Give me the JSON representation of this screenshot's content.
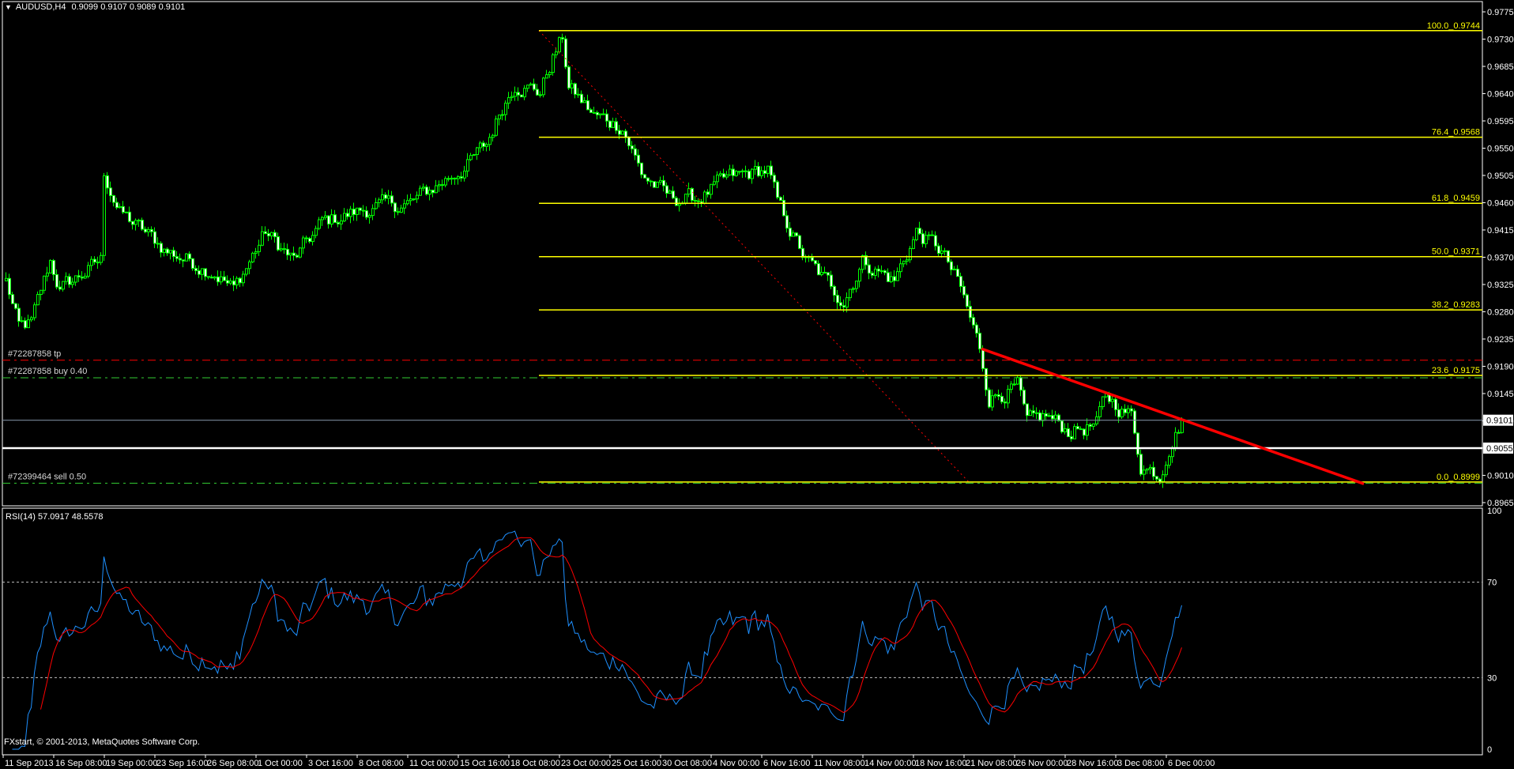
{
  "header": {
    "symbol": "AUDUSD,H4",
    "ohlc": "0.9099 0.9107 0.9089 0.9101",
    "menu_icon": "triangle-down-icon"
  },
  "copyright": "FXstart, © 2001-2013, MetaQuotes Software Corp.",
  "rsi": {
    "label": "RSI(14) 57.0917 48.5578",
    "period": 14,
    "signal_period": 9,
    "levels": [
      70,
      30
    ],
    "axis_labels": [
      {
        "text": "100",
        "value": 100
      },
      {
        "text": "70",
        "value": 70
      },
      {
        "text": "30",
        "value": 30
      },
      {
        "text": "0",
        "value": 0
      }
    ],
    "line_color": "#1e90ff",
    "signal_color": "#ff0000"
  },
  "orders": [
    {
      "label": "#72287858 tp",
      "price": 0.92,
      "color": "#ff0000"
    },
    {
      "label": "#72287858 buy 0.40",
      "price": 0.9171,
      "color": "#32cd32"
    },
    {
      "label": "#72399464 sell 0.50",
      "price": 0.8997,
      "color": "#32cd32"
    }
  ],
  "price_lines": [
    {
      "label": "0.9101",
      "price": 0.9101,
      "color": "#778899"
    },
    {
      "label": "0.9055",
      "price": 0.9055,
      "color": "#ffffff"
    }
  ],
  "chart_data": {
    "type": "candlestick",
    "title": "AUDUSD,H4",
    "bull_color": "#00ff00",
    "price_ticks": [
      "0.9775",
      "0.9730",
      "0.9685",
      "0.9640",
      "0.9595",
      "0.9550",
      "0.9505",
      "0.9460",
      "0.9415",
      "0.9370",
      "0.9325",
      "0.9280",
      "0.9235",
      "0.9190",
      "0.9145",
      "0.9100",
      "0.9055",
      "0.9010",
      "0.8965"
    ],
    "ylim": [
      0.8965,
      0.9775
    ],
    "bars_per_time_tick": 16,
    "time_ticks": [
      "11 Sep 2013",
      "16 Sep 08:00",
      "19 Sep 00:00",
      "23 Sep 16:00",
      "26 Sep 08:00",
      "1 Oct 00:00",
      "3 Oct 16:00",
      "8 Oct 08:00",
      "11 Oct 00:00",
      "15 Oct 16:00",
      "18 Oct 08:00",
      "23 Oct 00:00",
      "25 Oct 16:00",
      "30 Oct 08:00",
      "4 Nov 00:00",
      "6 Nov 16:00",
      "11 Nov 08:00",
      "14 Nov 00:00",
      "18 Nov 16:00",
      "21 Nov 08:00",
      "26 Nov 00:00",
      "28 Nov 16:00",
      "3 Dec 08:00",
      "6 Dec 00:00"
    ],
    "close_path": [
      [
        0,
        0.9331
      ],
      [
        4,
        0.9252
      ],
      [
        8,
        0.926
      ],
      [
        14,
        0.9364
      ],
      [
        17,
        0.9316
      ],
      [
        30,
        0.9364
      ],
      [
        31,
        0.9508
      ],
      [
        36,
        0.9444
      ],
      [
        51,
        0.938
      ],
      [
        66,
        0.9347
      ],
      [
        72,
        0.9316
      ],
      [
        82,
        0.9411
      ],
      [
        91,
        0.9364
      ],
      [
        100,
        0.9427
      ],
      [
        115,
        0.9451
      ],
      [
        128,
        0.9459
      ],
      [
        137,
        0.9491
      ],
      [
        146,
        0.9523
      ],
      [
        152,
        0.9555
      ],
      [
        157,
        0.9619
      ],
      [
        161,
        0.9659
      ],
      [
        169,
        0.9643
      ],
      [
        173,
        0.97
      ],
      [
        176,
        0.9731
      ],
      [
        178,
        0.9651
      ],
      [
        186,
        0.9603
      ],
      [
        195,
        0.9587
      ],
      [
        201,
        0.9508
      ],
      [
        210,
        0.9467
      ],
      [
        219,
        0.9467
      ],
      [
        229,
        0.95
      ],
      [
        241,
        0.9515
      ],
      [
        244,
        0.9459
      ],
      [
        253,
        0.9364
      ],
      [
        265,
        0.93
      ],
      [
        271,
        0.9364
      ],
      [
        281,
        0.9331
      ],
      [
        288,
        0.9411
      ],
      [
        296,
        0.938
      ],
      [
        302,
        0.9316
      ],
      [
        308,
        0.9219
      ],
      [
        311,
        0.914
      ],
      [
        320,
        0.9155
      ],
      [
        323,
        0.9092
      ],
      [
        329,
        0.9108
      ],
      [
        336,
        0.9084
      ],
      [
        345,
        0.9092
      ],
      [
        348,
        0.914
      ],
      [
        356,
        0.9108
      ],
      [
        359,
        0.9028
      ],
      [
        365,
        0.9012
      ],
      [
        368,
        0.9061
      ],
      [
        372,
        0.9101
      ]
    ],
    "fibonacci": {
      "start_bar": 169,
      "end_bar": 305,
      "high": 0.9744,
      "low": 0.8999,
      "color": "#ffff00",
      "levels": [
        {
          "label": "100.0_0.9744",
          "level": 100.0,
          "price": 0.9744
        },
        {
          "label": "76.4_0.9568",
          "level": 76.4,
          "price": 0.9568
        },
        {
          "label": "61.8_0.9459",
          "level": 61.8,
          "price": 0.9459
        },
        {
          "label": "50.0_0.9371",
          "level": 50.0,
          "price": 0.9371
        },
        {
          "label": "38.2_0.9283",
          "level": 38.2,
          "price": 0.9283
        },
        {
          "label": "23.6_0.9175",
          "level": 23.6,
          "price": 0.9175
        },
        {
          "label": "0.0_0.8999",
          "level": 0.0,
          "price": 0.8999
        }
      ]
    },
    "trendline": {
      "from": [
        309,
        0.9219
      ],
      "to": [
        430,
        0.8996
      ],
      "color": "#ff0000"
    }
  }
}
